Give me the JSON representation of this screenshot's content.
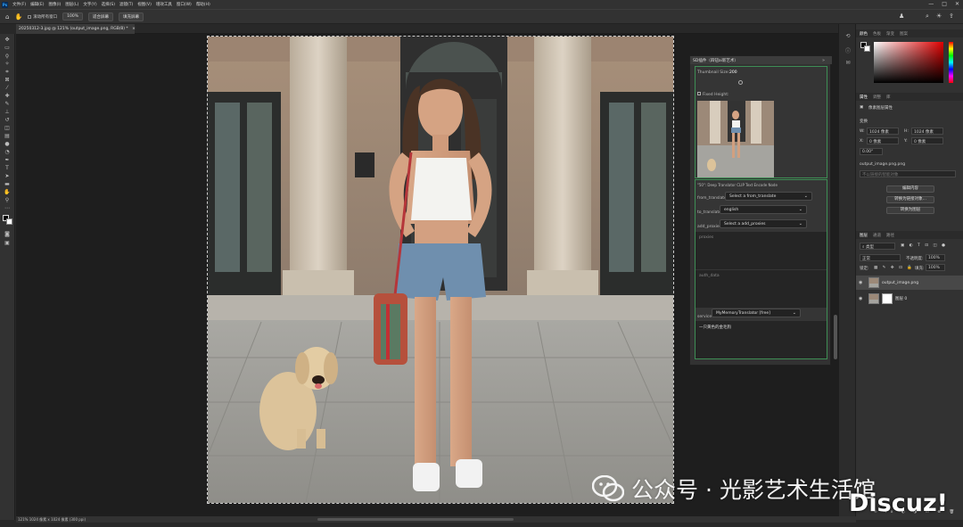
{
  "app": {
    "logo": "Ps"
  },
  "menu": [
    "文件(F)",
    "编辑(E)",
    "图像(I)",
    "图层(L)",
    "文字(Y)",
    "选择(S)",
    "滤镜(T)",
    "视图(V)",
    "增效工具",
    "窗口(W)",
    "帮助(H)"
  ],
  "window_controls": [
    "—",
    "□",
    "✕"
  ],
  "options": {
    "scroll_all": "滚动所有窗口",
    "zoom": "100%",
    "fit_screen": "适合屏幕",
    "fill_screen": "填充屏幕"
  },
  "document_tab": "20250312-3.jpg @ 121% (output_image.png, RGB/8) *",
  "status": "121%   1024 像素 x 1024 像素 (300 ppi)",
  "node_panel": {
    "title": "SD插件（四钮ai新艺术）",
    "thumbnail_size_label": "Thumbnail Size:",
    "thumbnail_size_value": "200",
    "fixed_height": "Fixed Height:",
    "node_title": "\"50\": Deep Translator CLIP Text Encode Node",
    "from_translate_label": "from_translate",
    "from_translate_value": "Select a from_translate",
    "to_translate_label": "to_translate",
    "to_translate_value": "english",
    "add_proxies_label": "add_proxies",
    "add_proxies_value": "Select a add_proxies",
    "proxies_placeholder": "proxies",
    "auth_data_placeholder": "auth_data",
    "service_label": "service",
    "service_value": "MyMemoryTranslator [free]",
    "text_value": "一只黄色的金毛狗"
  },
  "right_panel": {
    "color_tabs": [
      "颜色",
      "色板",
      "渐变",
      "图案"
    ],
    "props_tabs": [
      "属性",
      "调整",
      "库"
    ],
    "pixel_layer": "像素图层属性",
    "transform": "变换",
    "w_label": "W:",
    "w_value": "1024 像素",
    "h_label": "H:",
    "h_value": "1024 像素",
    "x_label": "X:",
    "x_value": "0 像素",
    "y_label": "Y:",
    "y_value": "0 像素",
    "angle_value": "0.00°",
    "filename": "output_image.png.png",
    "unlinked": "不以链接的智能对象",
    "edit_contents": "编辑内容",
    "convert_linked": "转换为链接对象...",
    "convert_layers": "转换为图层",
    "layers_tabs": [
      "图层",
      "通道",
      "路径"
    ],
    "filter_kind": "类型",
    "blend_mode": "正常",
    "opacity_label": "不透明度:",
    "opacity_value": "100%",
    "lock_label": "锁定:",
    "fill_label": "填充:",
    "fill_value": "100%",
    "layers": [
      {
        "name": "output_image.png"
      },
      {
        "name": "图层 0"
      }
    ]
  },
  "watermark": {
    "text": "公众号 · 光影艺术生活馆"
  },
  "brand": "Discuz!",
  "colors": {
    "accent": "#3e8e55",
    "ps_blue": "#31a8ff"
  }
}
